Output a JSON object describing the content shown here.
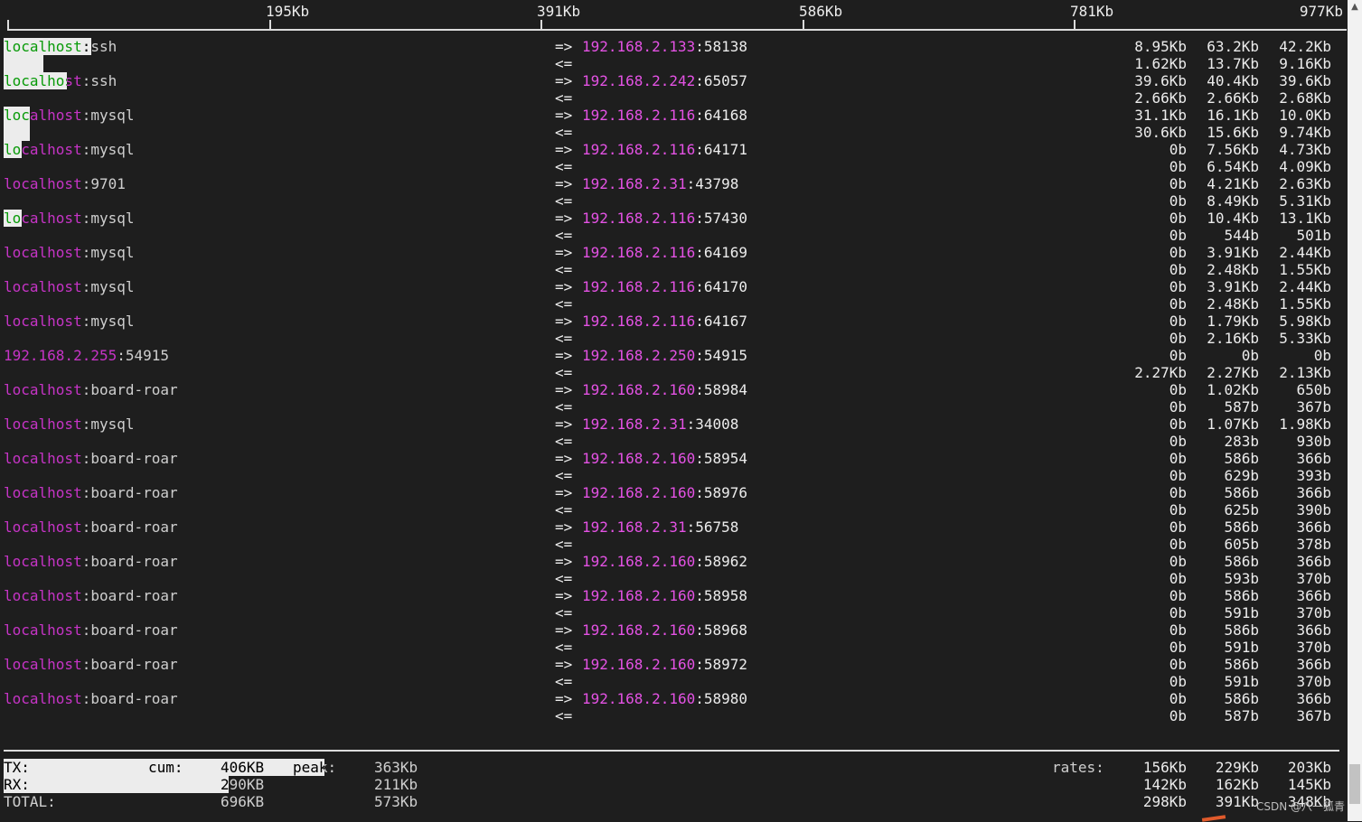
{
  "scale": {
    "ticks": [
      "195Kb",
      "391Kb",
      "586Kb",
      "781Kb",
      "977Kb"
    ]
  },
  "direction": {
    "out": "=>",
    "in": "<="
  },
  "connections": [
    {
      "host": "localhost",
      "service": "ssh",
      "dst_ip": "192.168.2.133",
      "dst_port": "58138",
      "tx": [
        "8.95Kb",
        "63.2Kb",
        "42.2Kb"
      ],
      "rx": [
        "1.62Kb",
        "13.7Kb",
        "9.16Kb"
      ],
      "tx_level": 0.0653,
      "rx_level": 0.0295
    },
    {
      "host": "localhost",
      "service": "ssh",
      "dst_ip": "192.168.2.242",
      "dst_port": "65057",
      "tx": [
        "39.6Kb",
        "40.4Kb",
        "39.6Kb"
      ],
      "rx": [
        "2.66Kb",
        "2.66Kb",
        "2.68Kb"
      ],
      "tx_level": 0.047,
      "rx_level": 0.0
    },
    {
      "host": "localhost",
      "service": "mysql",
      "dst_ip": "192.168.2.116",
      "dst_port": "64168",
      "tx": [
        "31.1Kb",
        "16.1Kb",
        "10.0Kb"
      ],
      "rx": [
        "30.6Kb",
        "15.6Kb",
        "9.74Kb"
      ],
      "tx_level": 0.0197,
      "rx_level": 0.0197
    },
    {
      "host": "localhost",
      "service": "mysql",
      "dst_ip": "192.168.2.116",
      "dst_port": "64171",
      "tx": [
        "0b",
        "7.56Kb",
        "4.73Kb"
      ],
      "rx": [
        "0b",
        "6.54Kb",
        "4.09Kb"
      ],
      "tx_level": 0.0135,
      "rx_level": 0.0
    },
    {
      "host": "localhost",
      "service": "9701",
      "dst_ip": "192.168.2.31",
      "dst_port": "43798",
      "tx": [
        "0b",
        "4.21Kb",
        "2.63Kb"
      ],
      "rx": [
        "0b",
        "8.49Kb",
        "5.31Kb"
      ],
      "tx_level": 0.0,
      "rx_level": 0.0
    },
    {
      "host": "localhost",
      "service": "mysql",
      "dst_ip": "192.168.2.116",
      "dst_port": "57430",
      "tx": [
        "0b",
        "10.4Kb",
        "13.1Kb"
      ],
      "rx": [
        "0b",
        "544b",
        "501b"
      ],
      "tx_level": 0.0135,
      "rx_level": 0.0
    },
    {
      "host": "localhost",
      "service": "mysql",
      "dst_ip": "192.168.2.116",
      "dst_port": "64169",
      "tx": [
        "0b",
        "3.91Kb",
        "2.44Kb"
      ],
      "rx": [
        "0b",
        "2.48Kb",
        "1.55Kb"
      ],
      "tx_level": 0.0,
      "rx_level": 0.0
    },
    {
      "host": "localhost",
      "service": "mysql",
      "dst_ip": "192.168.2.116",
      "dst_port": "64170",
      "tx": [
        "0b",
        "3.91Kb",
        "2.44Kb"
      ],
      "rx": [
        "0b",
        "2.48Kb",
        "1.55Kb"
      ],
      "tx_level": 0.0,
      "rx_level": 0.0
    },
    {
      "host": "localhost",
      "service": "mysql",
      "dst_ip": "192.168.2.116",
      "dst_port": "64167",
      "tx": [
        "0b",
        "1.79Kb",
        "5.98Kb"
      ],
      "rx": [
        "0b",
        "2.16Kb",
        "5.33Kb"
      ],
      "tx_level": 0.0,
      "rx_level": 0.0
    },
    {
      "host": "192.168.2.255",
      "service": "54915",
      "dst_ip": "192.168.2.250",
      "dst_port": "54915",
      "tx": [
        "0b",
        "0b",
        "0b"
      ],
      "rx": [
        "2.27Kb",
        "2.27Kb",
        "2.13Kb"
      ],
      "tx_level": 0.0,
      "rx_level": 0.0
    },
    {
      "host": "localhost",
      "service": "board-roar",
      "dst_ip": "192.168.2.160",
      "dst_port": "58984",
      "tx": [
        "0b",
        "1.02Kb",
        "650b"
      ],
      "rx": [
        "0b",
        "587b",
        "367b"
      ],
      "tx_level": 0.0,
      "rx_level": 0.0
    },
    {
      "host": "localhost",
      "service": "mysql",
      "dst_ip": "192.168.2.31",
      "dst_port": "34008",
      "tx": [
        "0b",
        "1.07Kb",
        "1.98Kb"
      ],
      "rx": [
        "0b",
        "283b",
        "930b"
      ],
      "tx_level": 0.0,
      "rx_level": 0.0
    },
    {
      "host": "localhost",
      "service": "board-roar",
      "dst_ip": "192.168.2.160",
      "dst_port": "58954",
      "tx": [
        "0b",
        "586b",
        "366b"
      ],
      "rx": [
        "0b",
        "629b",
        "393b"
      ],
      "tx_level": 0.0,
      "rx_level": 0.0
    },
    {
      "host": "localhost",
      "service": "board-roar",
      "dst_ip": "192.168.2.160",
      "dst_port": "58976",
      "tx": [
        "0b",
        "586b",
        "366b"
      ],
      "rx": [
        "0b",
        "625b",
        "390b"
      ],
      "tx_level": 0.0,
      "rx_level": 0.0
    },
    {
      "host": "localhost",
      "service": "board-roar",
      "dst_ip": "192.168.2.31",
      "dst_port": "56758",
      "tx": [
        "0b",
        "586b",
        "366b"
      ],
      "rx": [
        "0b",
        "605b",
        "378b"
      ],
      "tx_level": 0.0,
      "rx_level": 0.0
    },
    {
      "host": "localhost",
      "service": "board-roar",
      "dst_ip": "192.168.2.160",
      "dst_port": "58962",
      "tx": [
        "0b",
        "586b",
        "366b"
      ],
      "rx": [
        "0b",
        "593b",
        "370b"
      ],
      "tx_level": 0.0,
      "rx_level": 0.0
    },
    {
      "host": "localhost",
      "service": "board-roar",
      "dst_ip": "192.168.2.160",
      "dst_port": "58958",
      "tx": [
        "0b",
        "586b",
        "366b"
      ],
      "rx": [
        "0b",
        "591b",
        "370b"
      ],
      "tx_level": 0.0,
      "rx_level": 0.0
    },
    {
      "host": "localhost",
      "service": "board-roar",
      "dst_ip": "192.168.2.160",
      "dst_port": "58968",
      "tx": [
        "0b",
        "586b",
        "366b"
      ],
      "rx": [
        "0b",
        "591b",
        "370b"
      ],
      "tx_level": 0.0,
      "rx_level": 0.0
    },
    {
      "host": "localhost",
      "service": "board-roar",
      "dst_ip": "192.168.2.160",
      "dst_port": "58972",
      "tx": [
        "0b",
        "586b",
        "366b"
      ],
      "rx": [
        "0b",
        "591b",
        "370b"
      ],
      "tx_level": 0.0,
      "rx_level": 0.0
    },
    {
      "host": "localhost",
      "service": "board-roar",
      "dst_ip": "192.168.2.160",
      "dst_port": "58980",
      "tx": [
        "0b",
        "586b",
        "366b"
      ],
      "rx": [
        "0b",
        "587b",
        "367b"
      ],
      "tx_level": 0.0,
      "rx_level": 0.0
    }
  ],
  "totals": {
    "tx_label": "TX:",
    "rx_label": "RX:",
    "total_label": "TOTAL:",
    "cum_label": "cum:",
    "peak_label": "peak:",
    "rates_label": "rates:",
    "tx_cum": "406KB",
    "rx_cum": "290KB",
    "total_cum": "696KB",
    "tx_peak": "363Kb",
    "rx_peak": "211Kb",
    "total_peak": "573Kb",
    "tx_rates": [
      "156Kb",
      "229Kb",
      "203Kb"
    ],
    "rx_rates": [
      "142Kb",
      "162Kb",
      "145Kb"
    ],
    "total_rates": [
      "298Kb",
      "391Kb",
      "348Kb"
    ],
    "tx_level": 0.2394,
    "rx_level": 0.1681
  },
  "watermark": "CSDN @八一狐青",
  "colors": {
    "background": "#1e1e1e",
    "text": "#ececec",
    "host_magenta": "#e452e4",
    "bar": "#ececec"
  }
}
